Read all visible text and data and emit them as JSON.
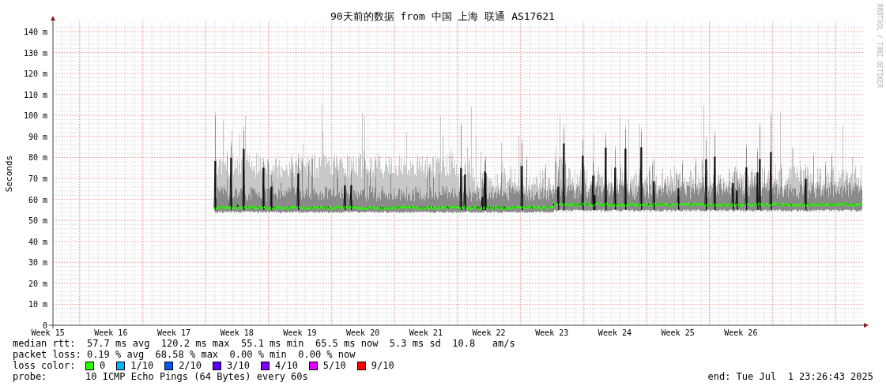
{
  "chart": {
    "title": "90天前的数据 from 中国 上海 联通 AS17621",
    "y_label": "Seconds",
    "credit": "RRDTOOL / TOBI OETIKER",
    "y_ticks": [
      "140 m",
      "130 m",
      "120 m",
      "110 m",
      "100 m",
      "90 m",
      "80 m",
      "70 m",
      "60 m",
      "50 m",
      "40 m",
      "30 m",
      "20 m",
      "10 m",
      "0"
    ],
    "x_ticks": [
      "Week 15",
      "Week 16",
      "Week 17",
      "Week 18",
      "Week 19",
      "Week 20",
      "Week 21",
      "Week 22",
      "Week 23",
      "Week 24",
      "Week 25",
      "Week 26"
    ]
  },
  "legend": {
    "median_rtt": "median rtt:  57.7 ms avg  120.2 ms max  55.1 ms min  65.5 ms now  5.3 ms sd  10.8   am/s",
    "packet_loss": "packet loss: 0.19 % avg  68.58 % max  0.00 % min  0.00 % now",
    "loss_color_label": "loss color:",
    "loss_colors": [
      {
        "label": "0",
        "color": "#26ff00"
      },
      {
        "label": "1/10",
        "color": "#00b8ff"
      },
      {
        "label": "2/10",
        "color": "#0059ff"
      },
      {
        "label": "3/10",
        "color": "#5e00ff"
      },
      {
        "label": "4/10",
        "color": "#7e00ff"
      },
      {
        "label": "5/10",
        "color": "#dd00ff"
      },
      {
        "label": "9/10",
        "color": "#ff0000"
      }
    ],
    "probe_label": "probe:",
    "probe": "10 ICMP Echo Pings (64 Bytes) every 60s",
    "end": "end: Tue Jul  1 23:26:43 2025"
  }
}
